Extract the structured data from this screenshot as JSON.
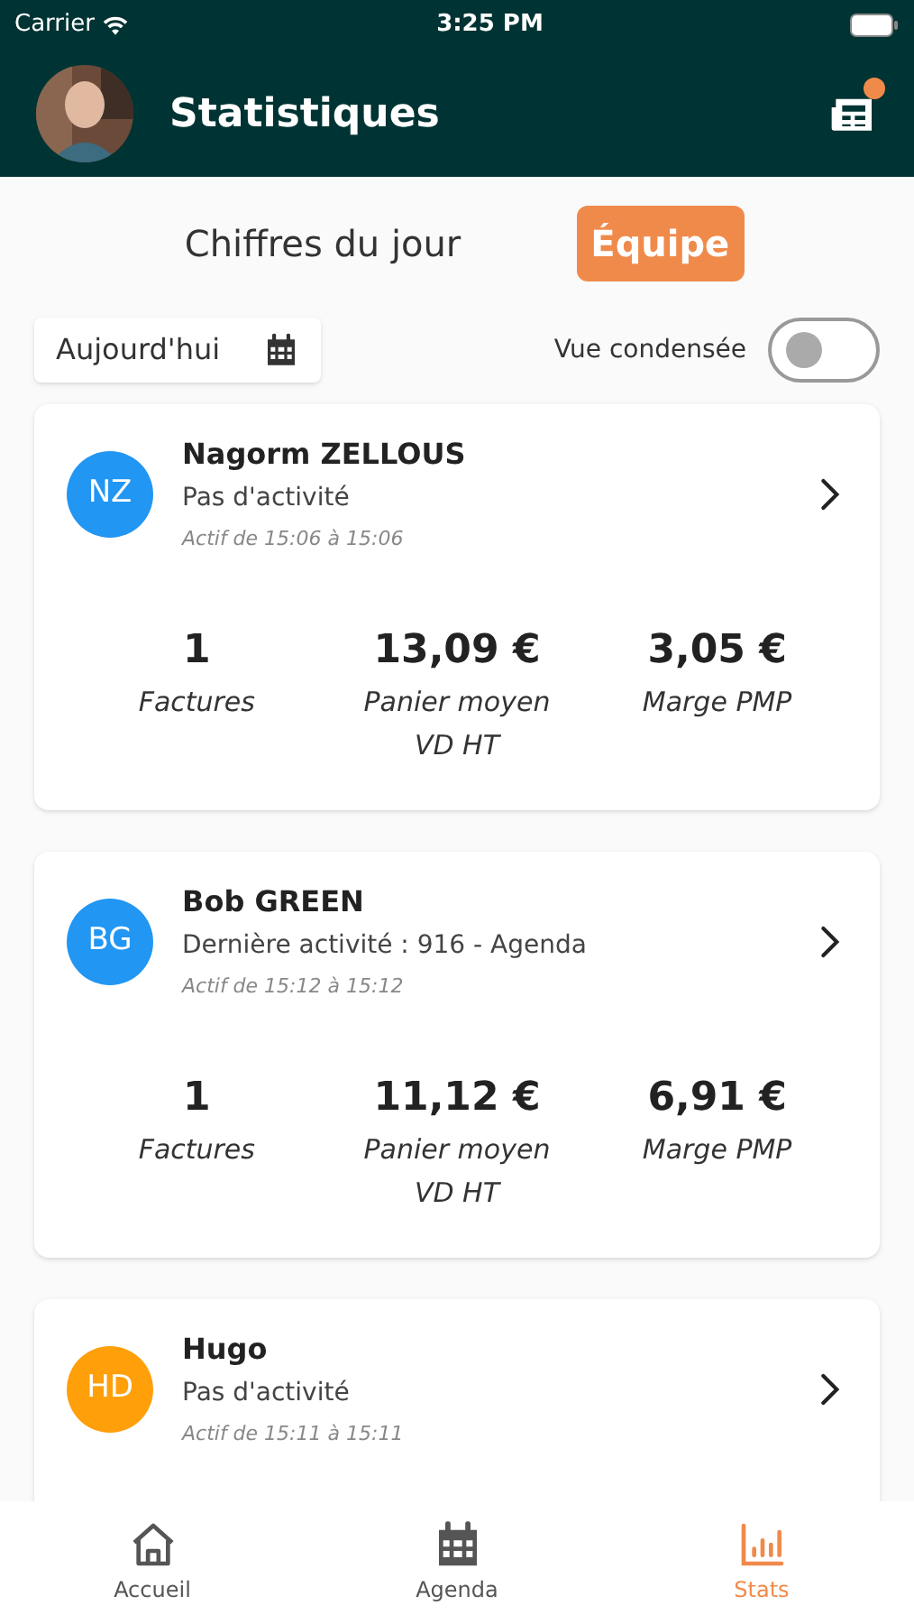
{
  "status_bar": {
    "carrier": "Carrier",
    "time": "3:25 PM"
  },
  "header": {
    "title": "Statistiques",
    "notification": true
  },
  "segments": [
    {
      "label": "Chiffres du jour",
      "selected": false
    },
    {
      "label": "Équipe",
      "selected": true
    }
  ],
  "date_field": {
    "value": "Aujourd'hui"
  },
  "condensed_toggle": {
    "label": "Vue condensée",
    "on": false
  },
  "users": [
    {
      "initials": "NZ",
      "color": "#2196f3",
      "name": "Nagorm ZELLOUS",
      "activity": "Pas d'activité",
      "active_range": "Actif de 15:06 à 15:06",
      "stats": [
        {
          "value": "1",
          "label": "Factures"
        },
        {
          "value": "13,09 €",
          "label": "Panier moyen VD HT"
        },
        {
          "value": "3,05 €",
          "label": "Marge PMP"
        }
      ]
    },
    {
      "initials": "BG",
      "color": "#2196f3",
      "name": "Bob GREEN",
      "activity": "Dernière activité : 916 - Agenda",
      "active_range": "Actif de 15:12 à 15:12",
      "stats": [
        {
          "value": "1",
          "label": "Factures"
        },
        {
          "value": "11,12 €",
          "label": "Panier moyen VD HT"
        },
        {
          "value": "6,91 €",
          "label": "Marge PMP"
        }
      ]
    },
    {
      "initials": "HD",
      "color": "#ff9f0a",
      "name": "Hugo",
      "activity": "Pas d'activité",
      "active_range": "Actif de 15:11 à 15:11"
    }
  ],
  "tab_bar": [
    {
      "kind": "home",
      "label": "Accueil",
      "selected": false
    },
    {
      "kind": "calendar",
      "label": "Agenda",
      "selected": false
    },
    {
      "kind": "stats",
      "label": "Stats",
      "selected": true
    }
  ]
}
